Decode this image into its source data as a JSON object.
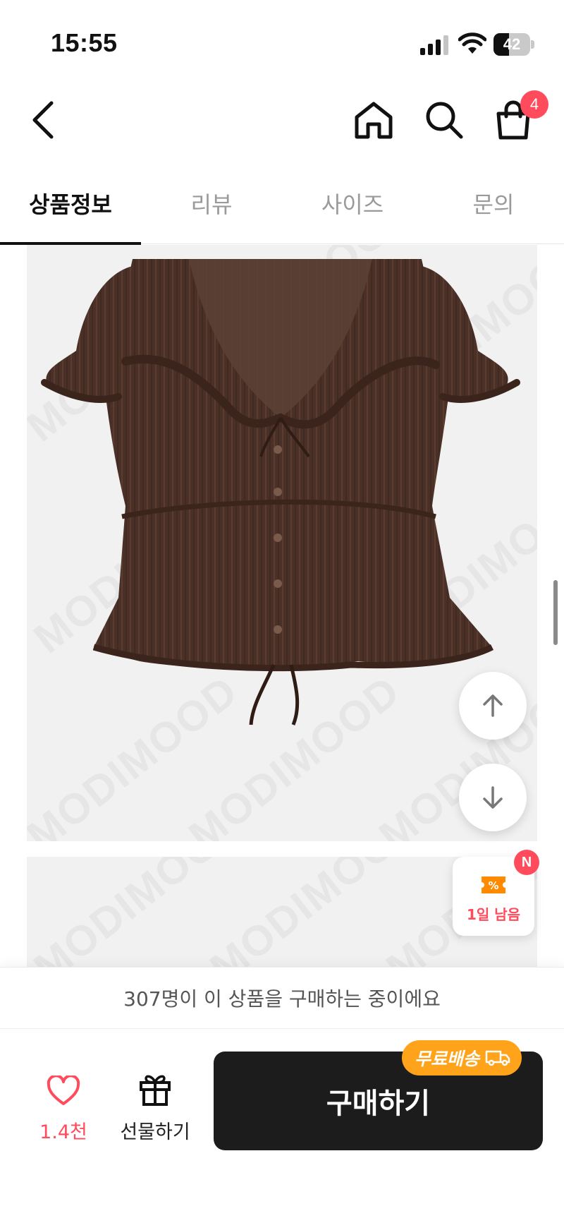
{
  "status_bar": {
    "time": "15:55",
    "battery": "42",
    "battery_level": 0.42
  },
  "header": {
    "icons": [
      "back-icon",
      "home-icon",
      "search-icon",
      "cart-icon"
    ],
    "cart_badge": "4"
  },
  "tabs": [
    {
      "label": "상품정보",
      "active": true
    },
    {
      "label": "리뷰",
      "active": false
    },
    {
      "label": "사이즈",
      "active": false
    },
    {
      "label": "문의",
      "active": false
    }
  ],
  "product": {
    "watermark": "MODIMOOD",
    "image": "brown-ruffle-blouse"
  },
  "floating": {
    "coupon_text": "1일 남음",
    "coupon_badge": "N"
  },
  "notice": {
    "text": "307명이 이 상품을 구매하는 중이에요"
  },
  "bottom_bar": {
    "like_count": "1.4천",
    "gift_label": "선물하기",
    "buy_label": "구매하기",
    "free_shipping_label": "무료배송"
  },
  "colors": {
    "accent_red": "#ff4b5c",
    "shipping_orange": "#ffa31a",
    "buy_button": "#1c1c1c",
    "product_bg": "#f1f1f1",
    "blouse_brown": "#4a3026"
  }
}
